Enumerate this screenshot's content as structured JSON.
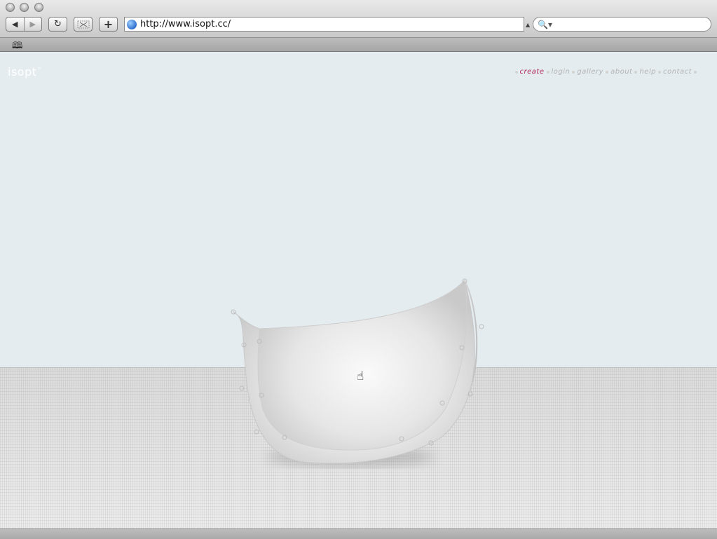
{
  "browser": {
    "url": "http://www.isopt.cc/",
    "back_icon": "◀",
    "forward_icon": "▶",
    "reload_icon": "↻",
    "add_icon": "+",
    "search_icon": "🔍▾",
    "bookmarks_icon": "🕮"
  },
  "site": {
    "logo": "isopt",
    "logo_mark": "™",
    "nav": [
      {
        "label": "create",
        "active": true
      },
      {
        "label": "login",
        "active": false
      },
      {
        "label": "gallery",
        "active": false
      },
      {
        "label": "about",
        "active": false
      },
      {
        "label": "help",
        "active": false
      },
      {
        "label": "contact",
        "active": false
      }
    ]
  },
  "colors": {
    "sky": "#e5ecf0",
    "floor": "#e2e2e2",
    "nav_active": "#b0285e",
    "nav_inactive": "#b3b3b3",
    "logo": "#ffffff"
  }
}
